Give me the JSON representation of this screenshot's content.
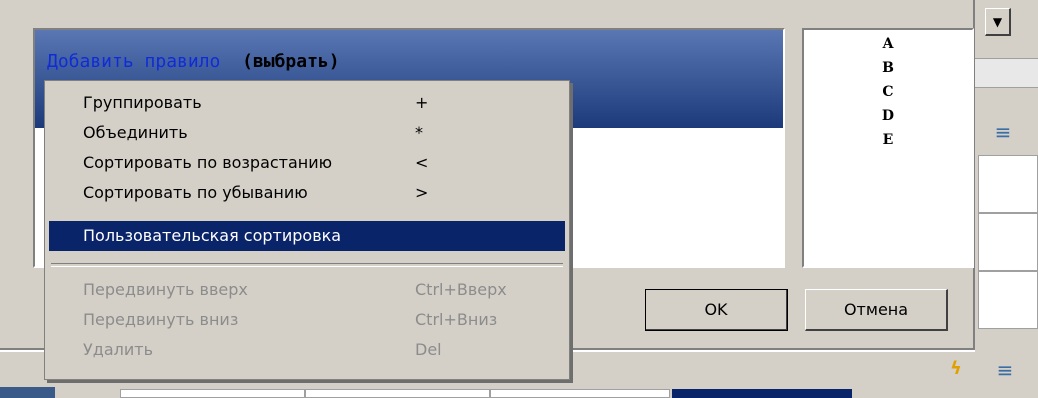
{
  "rule_box": {
    "title": "Добавить правило",
    "title_bold": "(выбрать)"
  },
  "letters": [
    "A",
    "B",
    "C",
    "D",
    "E"
  ],
  "buttons": {
    "ok": "OK",
    "cancel": "Отмена"
  },
  "menu": {
    "items": [
      {
        "label": "Группировать",
        "shortcut": "+",
        "state": "normal"
      },
      {
        "label": "Объединить",
        "shortcut": "*",
        "state": "normal"
      },
      {
        "label": "Сортировать по возрастанию",
        "shortcut": "<",
        "state": "normal"
      },
      {
        "label": "Сортировать по убыванию",
        "shortcut": ">",
        "state": "normal"
      },
      {
        "label": "Пользовательская сортировка",
        "shortcut": "",
        "state": "selected"
      },
      {
        "label": "Передвинуть вверх",
        "shortcut": "Ctrl+Вверх",
        "state": "disabled"
      },
      {
        "label": "Передвинуть вниз",
        "shortcut": "Ctrl+Вниз",
        "state": "disabled"
      },
      {
        "label": "Удалить",
        "shortcut": "Del",
        "state": "disabled"
      }
    ]
  },
  "colors": {
    "dialog_bg": "#d4d0c8",
    "selection": "#0a246a",
    "title_blue": "#0f2cd6",
    "disabled_text": "#8c8c8c"
  },
  "icons": {
    "dropdown": "chevron-down-icon",
    "sort_top": "sort-icon",
    "sort_bottom": "sort-icon",
    "lightning": "lightning-icon"
  }
}
